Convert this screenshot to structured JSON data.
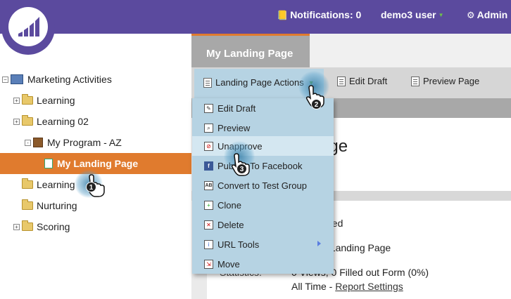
{
  "header": {
    "notifications_label": "Notifications: 0",
    "user_label": "demo3 user",
    "admin_label": "Admin",
    "bar_color": "#5b4a9e"
  },
  "tree": {
    "root": "Marketing Activities",
    "items": [
      {
        "label": "Learning",
        "expander": "+"
      },
      {
        "label": "Learning 02",
        "expander": "+"
      },
      {
        "label": "My Program - AZ",
        "expander": "-"
      },
      {
        "label": "My Landing Page",
        "selected": true
      },
      {
        "label": "Learning"
      },
      {
        "label": "Nurturing"
      },
      {
        "label": "Scoring",
        "expander": "+"
      }
    ]
  },
  "tab": {
    "label": "My Landing Page"
  },
  "toolbar": {
    "actions_label": "Landing Page Actions",
    "edit_draft_label": "Edit Draft",
    "preview_page_label": "Preview Page"
  },
  "menu": {
    "items": [
      {
        "label": "Edit Draft",
        "icon": "edit-icon"
      },
      {
        "label": "Preview",
        "icon": "preview-icon"
      },
      {
        "label": "Unapprove",
        "icon": "unapprove-icon",
        "highlighted": true
      },
      {
        "label": "Publish To Facebook",
        "icon": "facebook-icon"
      },
      {
        "label": "Convert to Test Group",
        "icon": "ab-test-icon"
      },
      {
        "label": "Clone",
        "icon": "clone-icon"
      },
      {
        "label": "Delete",
        "icon": "delete-icon"
      },
      {
        "label": "URL Tools",
        "icon": "url-tools-icon",
        "submenu": true
      },
      {
        "label": "Move",
        "icon": "move-icon"
      }
    ]
  },
  "content": {
    "title_partial": "age",
    "status_partial": "oved",
    "type_partial": "al Landing Page",
    "statistics_label": "Statistics:",
    "statistics_value": "0 Views, 0 Filled out Form (0%)",
    "all_time_label": "All Time - ",
    "report_settings_link": "Report Settings"
  },
  "callouts": [
    "1",
    "2",
    "3"
  ]
}
